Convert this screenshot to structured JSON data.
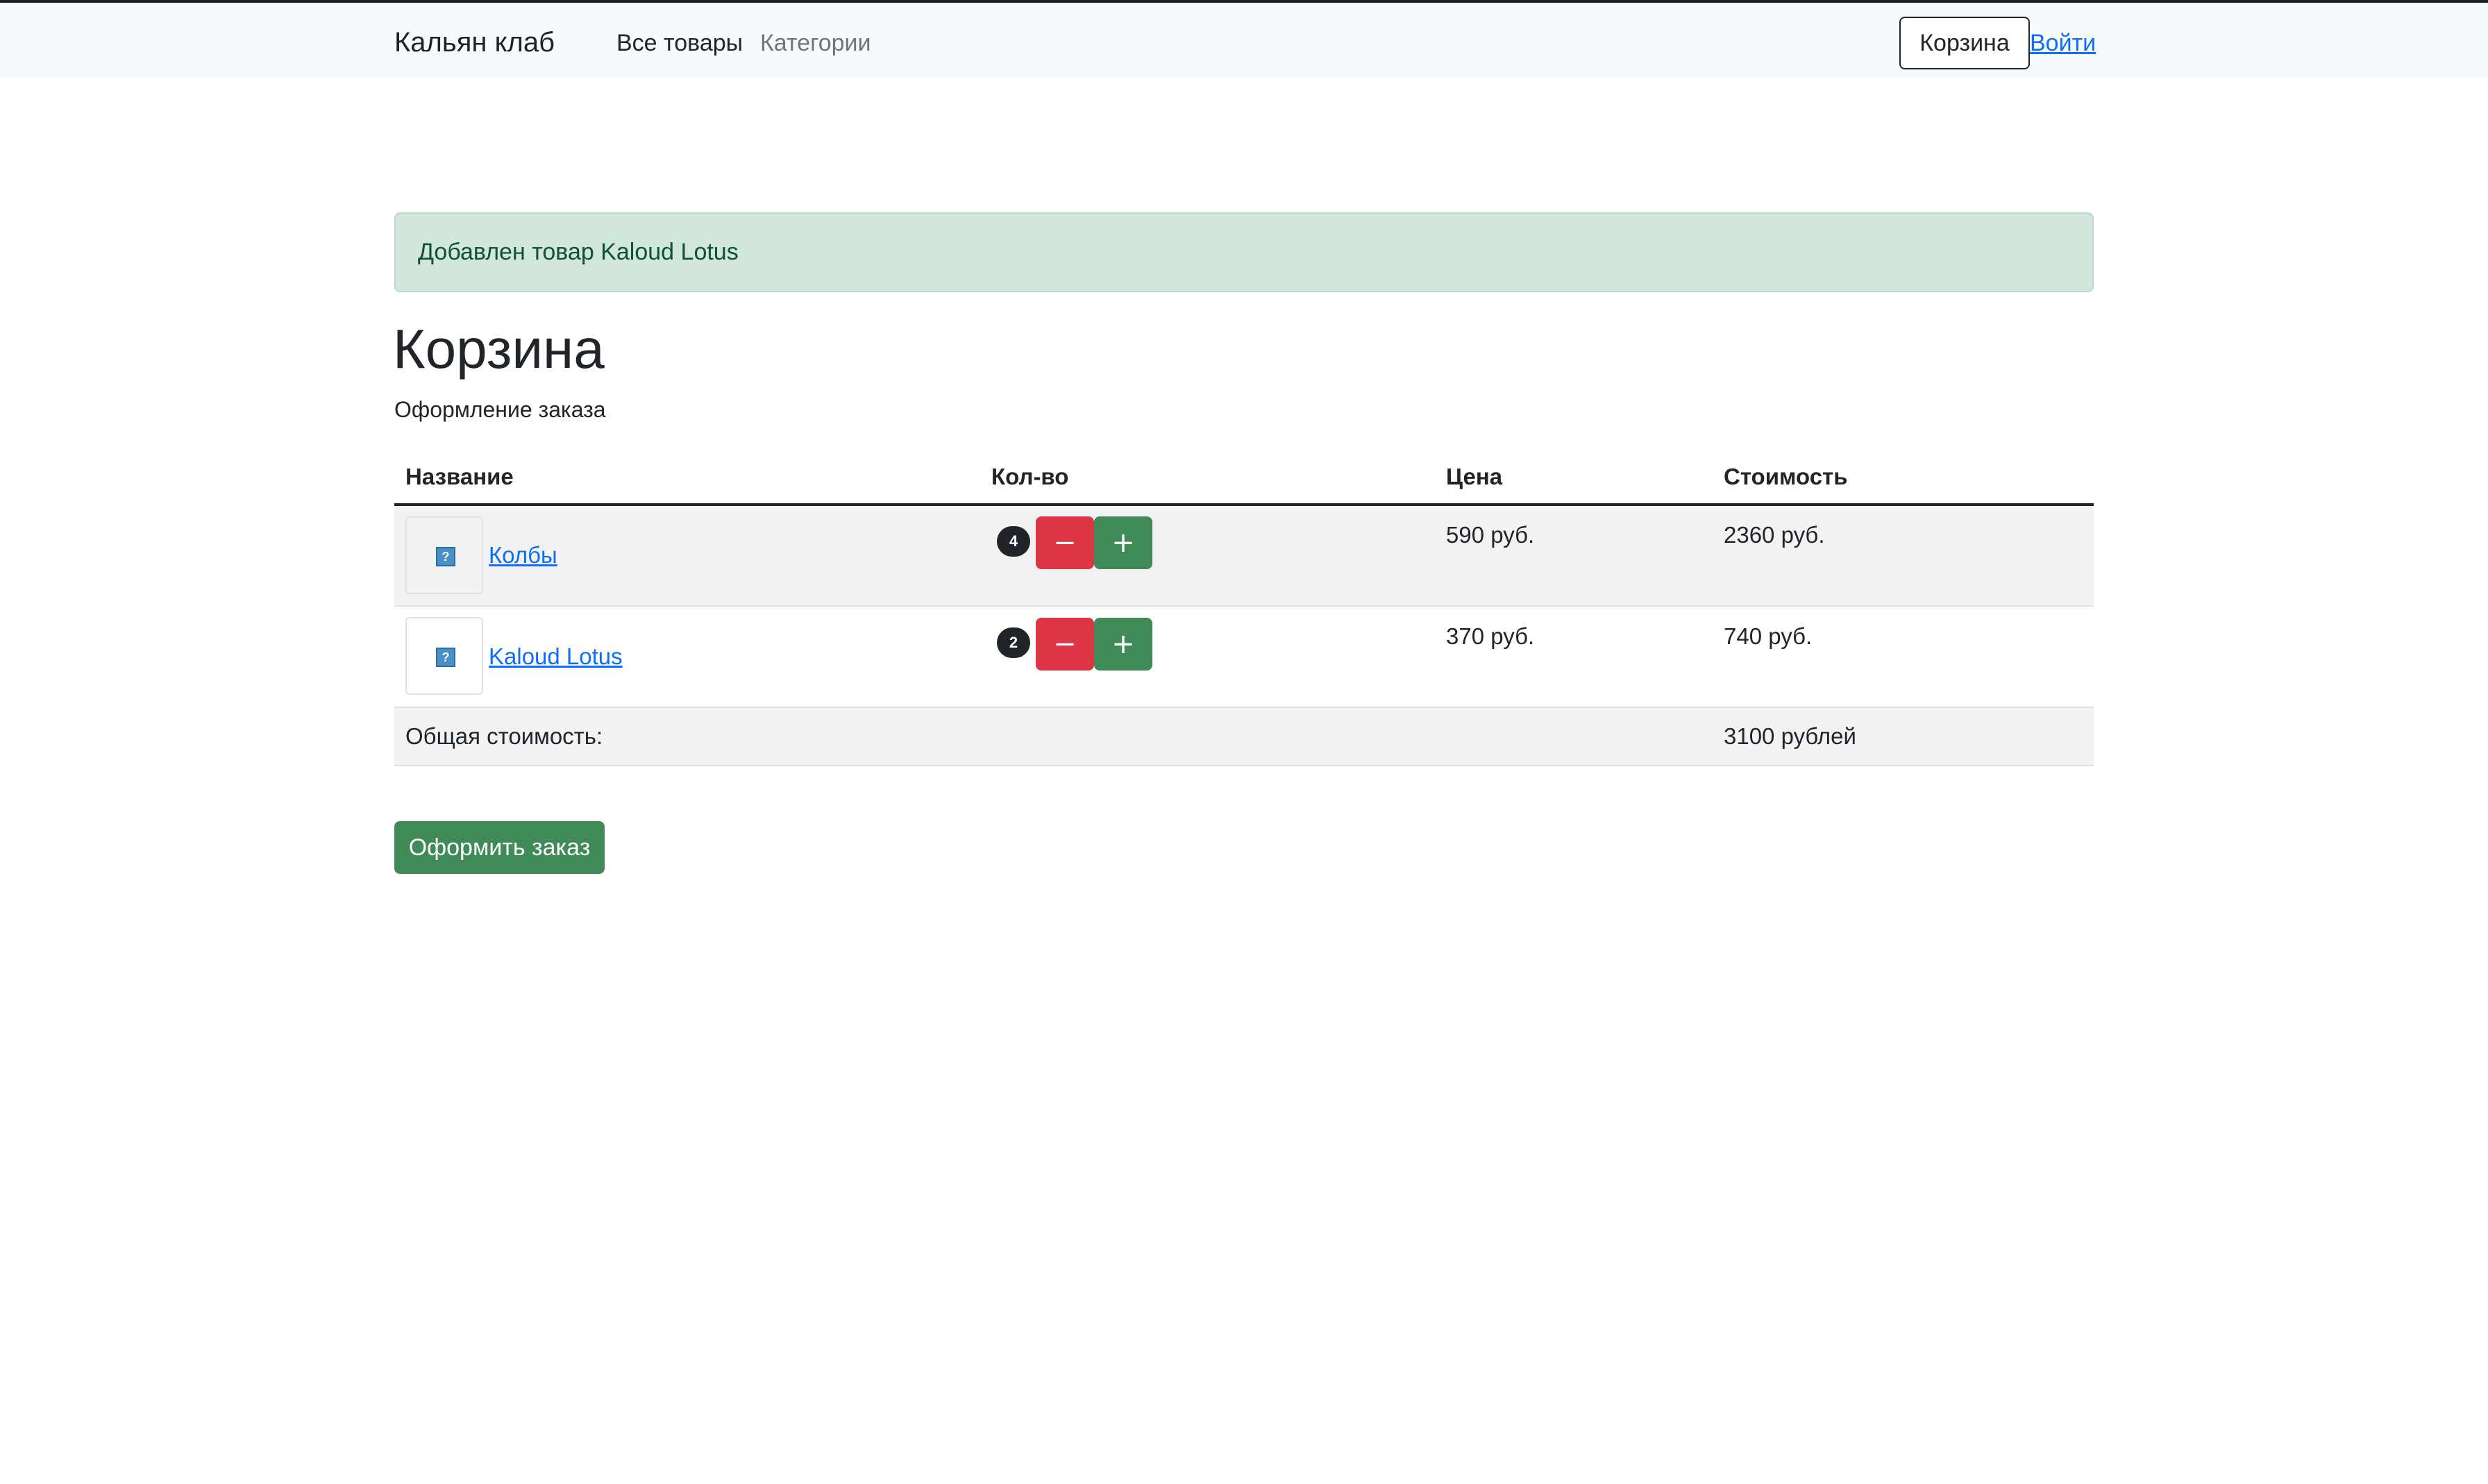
{
  "navbar": {
    "brand": "Кальян клаб",
    "links": [
      "Все товары",
      "Категории"
    ],
    "cart_button": "Корзина",
    "login_link": "Войти"
  },
  "alert": {
    "text": "Добавлен товар Kaloud Lotus"
  },
  "page": {
    "title": "Корзина",
    "subtitle": "Оформление заказа"
  },
  "table": {
    "headers": [
      "Название",
      "Кол-во",
      "Цена",
      "Стоимость"
    ],
    "rows": [
      {
        "name": "Колбы",
        "quantity": "4",
        "price": "590 руб.",
        "cost": "2360 руб.",
        "image_icon": "broken-image-icon"
      },
      {
        "name": "Kaloud Lotus",
        "quantity": "2",
        "price": "370 руб.",
        "cost": "740 руб.",
        "image_icon": "broken-image-icon"
      }
    ],
    "minus_symbol": "−",
    "plus_symbol": "+",
    "total_label": "Общая стоимость:",
    "total_value": "3100 рублей"
  },
  "order_button": "Оформить заказ",
  "colors": {
    "success_green": "#3f8a57",
    "danger_red": "#dc3545",
    "alert_bg": "#d1e7dd",
    "link_blue": "#0d6efd"
  }
}
